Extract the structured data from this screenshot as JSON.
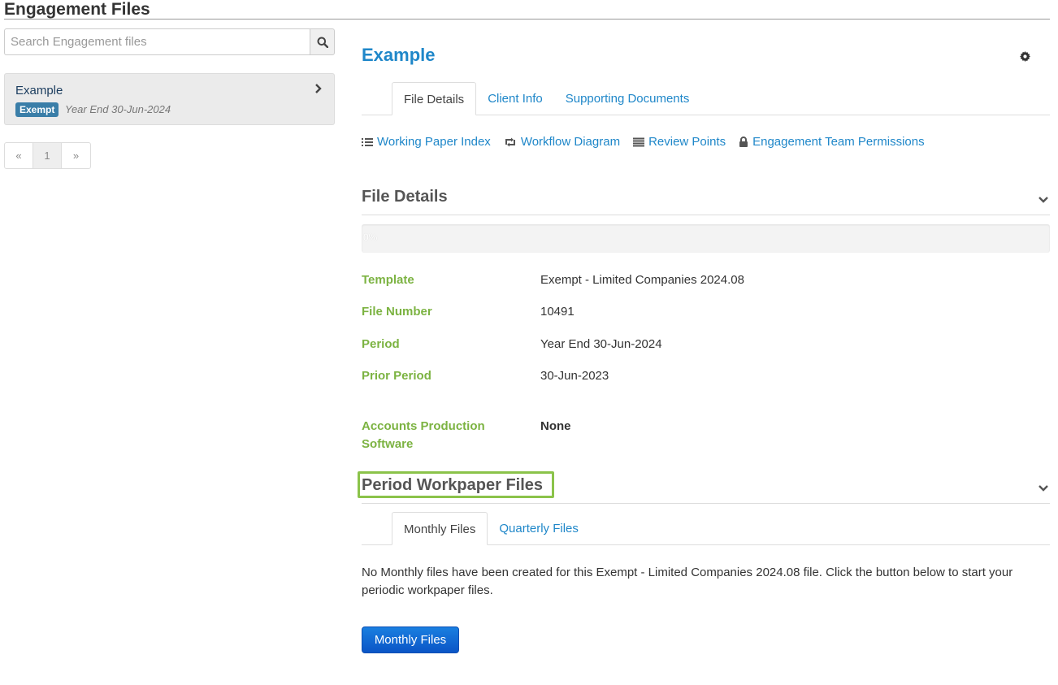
{
  "header": {
    "title": "Engagement Files"
  },
  "sidebar": {
    "search_placeholder": "Search Engagement files",
    "file": {
      "name": "Example",
      "badge": "Exempt",
      "period": "Year End 30-Jun-2024"
    },
    "pager": {
      "prev": "«",
      "page": "1",
      "next": "»"
    }
  },
  "main": {
    "title": "Example",
    "tabs": [
      {
        "label": "File Details",
        "active": true
      },
      {
        "label": "Client Info",
        "active": false
      },
      {
        "label": "Supporting Documents",
        "active": false
      }
    ],
    "links": [
      {
        "label": "Working Paper Index",
        "icon": "list-icon"
      },
      {
        "label": "Workflow Diagram",
        "icon": "retweet-icon"
      },
      {
        "label": "Review Points",
        "icon": "align-justify-icon"
      },
      {
        "label": "Engagement Team Permissions",
        "icon": "lock-icon"
      }
    ],
    "file_details": {
      "heading": "File Details",
      "progress": {
        "percent": 0,
        "label": "0%"
      },
      "rows": [
        {
          "label": "Template",
          "value": "Exempt - Limited Companies 2024.08"
        },
        {
          "label": "File Number",
          "value": "10491"
        },
        {
          "label": "Period",
          "value": "Year End 30-Jun-2024"
        },
        {
          "label": "Prior Period",
          "value": "30-Jun-2023"
        },
        {
          "label": "Accounts Production Software",
          "value": "None"
        }
      ]
    },
    "period_files": {
      "heading": "Period Workpaper Files",
      "tabs": [
        {
          "label": "Monthly Files",
          "active": true
        },
        {
          "label": "Quarterly Files",
          "active": false
        }
      ],
      "note": "No Monthly files have been created for this Exempt - Limited Companies 2024.08 file. Click the button below to start your periodic workpaper files.",
      "button": "Monthly Files"
    }
  },
  "colors": {
    "link": "#1f87c9",
    "label_green": "#7cb342",
    "highlight": "#8bc34a",
    "badge": "#3a7ea8",
    "primary_button": "#0a55c6"
  }
}
